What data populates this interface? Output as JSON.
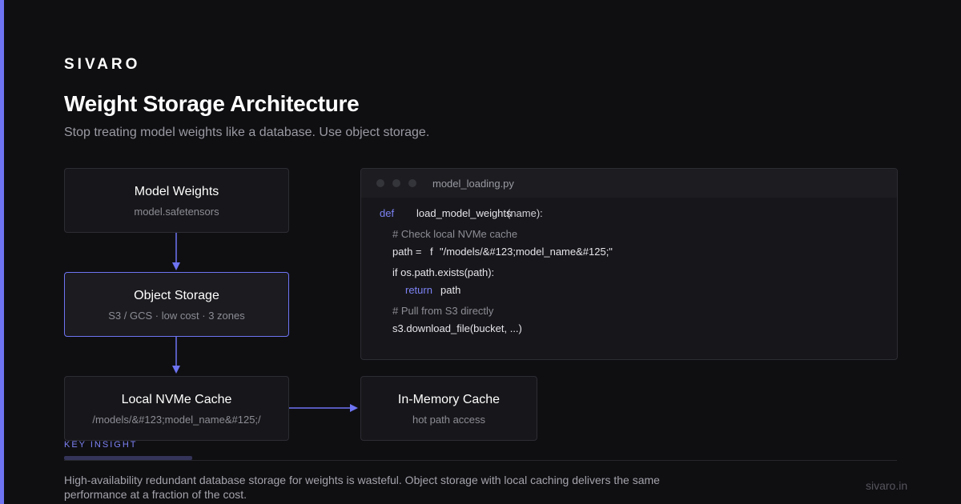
{
  "brand": "SIVARO",
  "title": "Weight Storage Architecture",
  "subtitle": "Stop treating model weights like a database. Use object storage.",
  "diagram": {
    "model_weights": {
      "title": "Model Weights",
      "sub": "model.safetensors"
    },
    "object_storage": {
      "title": "Object Storage",
      "sub": "S3 / GCS · low cost · 3 zones"
    },
    "local_cache": {
      "title": "Local NVMe Cache",
      "sub": "/models/&#123;model_name&#125;/"
    },
    "memory_cache": {
      "title": "In-Memory Cache",
      "sub": "hot path access"
    }
  },
  "code": {
    "filename": "model_loading.py",
    "kw_def": "def",
    "fn_name": "load_model_weights",
    "fn_overlap": "(name):",
    "comment1": "# Check local NVMe cache",
    "path_assign": "path =",
    "path_f": "f",
    "path_string": "\"/models/&#123;model_name&#125;\"",
    "if_line": "if os.path.exists(path):",
    "kw_return": "return",
    "return_val": "path",
    "comment2": "# Pull from S3 directly",
    "download": "s3.download_file(bucket, ...)"
  },
  "insight": {
    "label": "KEY INSIGHT",
    "text": "High-availability redundant database storage for weights is wasteful. Object storage with local caching delivers the same performance at a fraction of the cost."
  },
  "footer_url": "sivaro.in",
  "colors": {
    "accent": "#6e74f2",
    "background": "#0f0f12",
    "box": "#17171b",
    "border": "#2c2c33"
  }
}
